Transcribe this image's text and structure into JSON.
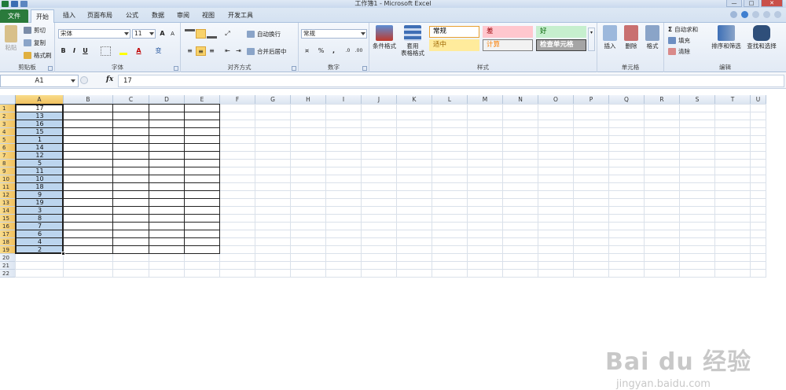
{
  "window": {
    "title": "工作簿1 - Microsoft Excel",
    "buttons": [
      "—",
      "□",
      "✕"
    ]
  },
  "ribbon_tabs": [
    "文件",
    "开始",
    "插入",
    "页面布局",
    "公式",
    "数据",
    "审阅",
    "视图",
    "开发工具"
  ],
  "ribbon": {
    "clipboard": {
      "label": "剪贴板",
      "paste": "粘贴",
      "cut": "剪切",
      "copy": "复制",
      "format_painter": "格式刷"
    },
    "font": {
      "label": "字体",
      "name": "宋体",
      "size": "11",
      "bold": "B",
      "italic": "I",
      "underline": "U",
      "grow": "A",
      "shrink": "A",
      "phonetic": "变"
    },
    "alignment": {
      "label": "对齐方式",
      "wrap": "自动换行",
      "merge": "合并后居中"
    },
    "number": {
      "label": "数字",
      "format": "常规",
      "percent": "%",
      "comma": ","
    },
    "styles": {
      "label": "样式",
      "conditional": "条件格式",
      "table_line1": "套用",
      "table_line2": "表格格式",
      "cells": [
        {
          "text": "常规",
          "bg": "#ffffff",
          "fg": "#000000",
          "border": "#e8a030"
        },
        {
          "text": "差",
          "bg": "#ffc7ce",
          "fg": "#9c0006",
          "border": "#ffc7ce"
        },
        {
          "text": "好",
          "bg": "#c6efce",
          "fg": "#006100",
          "border": "#c6efce"
        },
        {
          "text": "适中",
          "bg": "#ffeb9c",
          "fg": "#9c6500",
          "border": "#ffeb9c"
        },
        {
          "text": "计算",
          "bg": "#f2f2f2",
          "fg": "#fa7d00",
          "border": "#7f7f7f"
        },
        {
          "text": "检查单元格",
          "bg": "#a5a5a5",
          "fg": "#ffffff",
          "border": "#3f3f3f"
        }
      ]
    },
    "cells_group": {
      "label": "单元格",
      "insert": "插入",
      "delete": "删除",
      "format": "格式"
    },
    "editing": {
      "label": "编辑",
      "autosum": "自动求和",
      "fill": "填充",
      "clear": "清除",
      "sort": "排序和筛选",
      "find": "查找和选择"
    }
  },
  "formula_bar": {
    "name_box": "A1",
    "fx": "fx",
    "value": "17"
  },
  "sheet": {
    "columns": [
      "A",
      "B",
      "C",
      "D",
      "E",
      "F",
      "G",
      "H",
      "I",
      "J",
      "K",
      "L",
      "M",
      "N",
      "O",
      "P",
      "Q",
      "R",
      "S",
      "T",
      "U"
    ],
    "row_count": 22,
    "selected_col": "A",
    "col_a_values": [
      "17",
      "13",
      "16",
      "15",
      "1",
      "14",
      "12",
      "5",
      "11",
      "10",
      "18",
      "9",
      "19",
      "3",
      "8",
      "7",
      "6",
      "4",
      "2"
    ]
  },
  "watermark": {
    "line1": "Bai du 经验",
    "line2": "jingyan.baidu.com"
  }
}
